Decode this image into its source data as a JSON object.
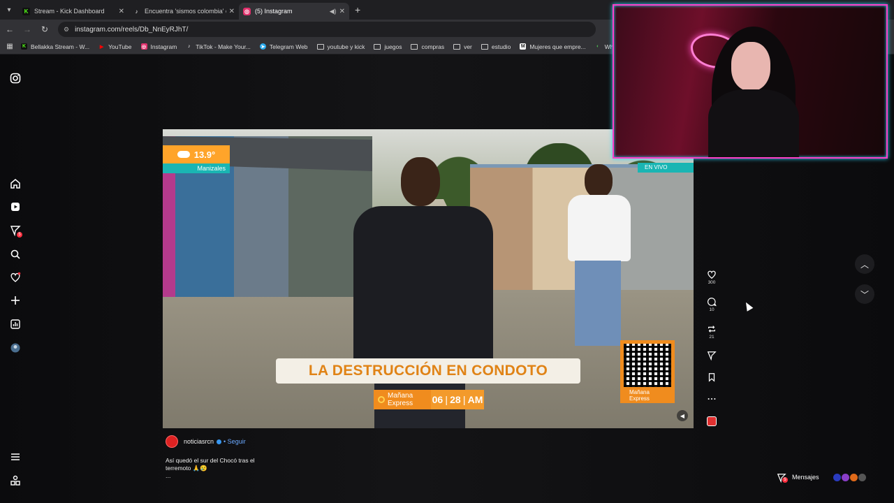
{
  "browser": {
    "tabs": [
      {
        "label": "Stream - Kick Dashboard",
        "favicon": "K",
        "color": "#53fc18"
      },
      {
        "label": "Encuentra 'sismos colombia' en",
        "favicon": "♪",
        "color": "#ffffff"
      },
      {
        "label": "(5) Instagram",
        "favicon": "◎",
        "color": "#e1306c"
      }
    ],
    "url": "instagram.com/reels/Db_NnEyRJhT/",
    "bookmarks": [
      {
        "label": "Bellakka Stream - W...",
        "icon": "K",
        "color": "#53fc18"
      },
      {
        "label": "YouTube",
        "icon": "▶",
        "color": "#ff0000"
      },
      {
        "label": "Instagram",
        "icon": "◎",
        "color": "#e1306c"
      },
      {
        "label": "TikTok - Make Your...",
        "icon": "♪",
        "color": "#ffffff"
      },
      {
        "label": "Telegram Web",
        "icon": "➤",
        "color": "#2aabee"
      },
      {
        "label": "youtube y kick",
        "icon": "folder"
      },
      {
        "label": "juegos",
        "icon": "folder"
      },
      {
        "label": "compras",
        "icon": "folder"
      },
      {
        "label": "ver",
        "icon": "folder"
      },
      {
        "label": "estudio",
        "icon": "folder"
      },
      {
        "label": "Mujeres que empre...",
        "icon": "M",
        "color": "#ffffff"
      },
      {
        "label": "Wheel of N",
        "icon": "◐",
        "color": "#4caf50"
      }
    ]
  },
  "sidebar": {
    "items": [
      "instagram-logo-icon",
      "home-icon",
      "reels-icon",
      "messages-icon",
      "search-icon",
      "notifications-icon",
      "create-icon",
      "dashboard-icon",
      "profile-avatar"
    ],
    "messages_badge": "5"
  },
  "video": {
    "temperature": "13.9°",
    "city": "Manizales",
    "live_label": "EN VIVO",
    "headline": "LA DESTRUCCIÓN EN CONDOTO",
    "brand_line1": "Mañana",
    "brand_line2": "Express",
    "time_hour": "06",
    "time_min": "28",
    "time_ampm": "AM",
    "qr_brand_line1": "Mañana",
    "qr_brand_line2": "Express"
  },
  "actions": {
    "likes": "300",
    "comments": "10",
    "reposts": "21"
  },
  "post": {
    "author": "noticiasrcn",
    "follow_label": "• Seguir",
    "caption": "Así quedó el sur del Chocó tras el terremoto 🙏😢",
    "more": "..."
  },
  "messages": {
    "label": "Mensajes",
    "badge": "5"
  },
  "colors": {
    "accent_orange": "#f08c1e",
    "teal": "#1ab5b3",
    "neon_pink": "#ff3fc8"
  }
}
